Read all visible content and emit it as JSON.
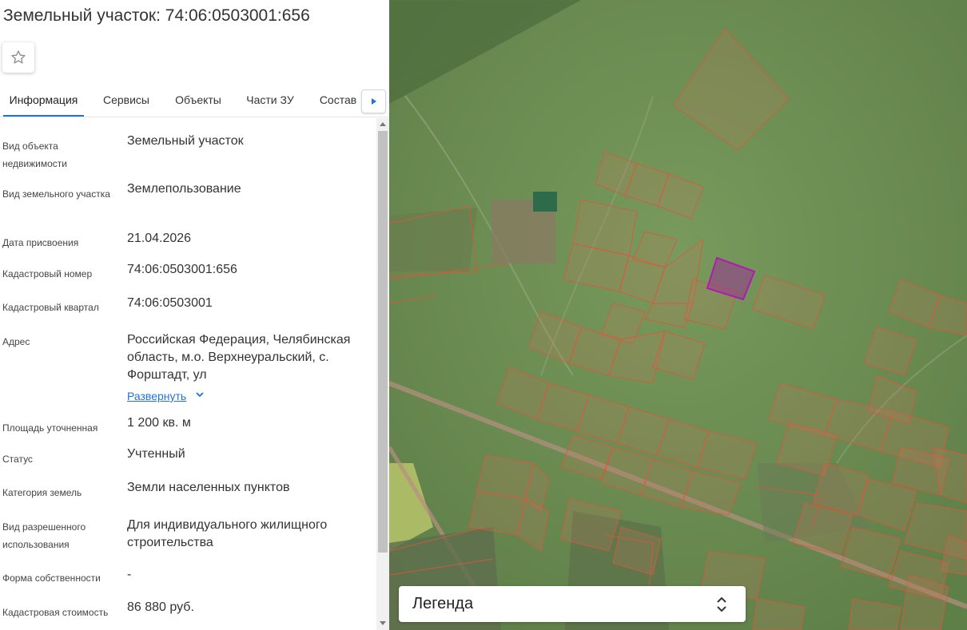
{
  "header": {
    "title": "Земельный участок: 74:06:0503001:656"
  },
  "tabs": [
    {
      "label": "Информация",
      "active": true
    },
    {
      "label": "Сервисы",
      "active": false
    },
    {
      "label": "Объекты",
      "active": false
    },
    {
      "label": "Части ЗУ",
      "active": false
    },
    {
      "label": "Состав",
      "active": false
    }
  ],
  "info": {
    "object_type": {
      "label": "Вид объекта недвижимости",
      "value": "Земельный участок"
    },
    "plot_type": {
      "label": "Вид земельного участка",
      "value": "Землепользование"
    },
    "date": {
      "label": "Дата присвоения",
      "value": "21.04.2026"
    },
    "cad_number": {
      "label": "Кадастровый номер",
      "value": "74:06:0503001:656"
    },
    "cad_quarter": {
      "label": "Кадастровый квартал",
      "value": "74:06:0503001"
    },
    "address": {
      "label": "Адрес",
      "value": "Российская Федерация, Челябинская область, м.о. Верхнеуральский, с. Форштадт, ул",
      "expand_label": "Развернуть"
    },
    "area": {
      "label": "Площадь уточненная",
      "value": "1 200 кв. м"
    },
    "status": {
      "label": "Статус",
      "value": "Учтенный"
    },
    "category": {
      "label": "Категория земель",
      "value": "Земли населенных пунктов"
    },
    "permitted_use": {
      "label": "Вид разрешенного использования",
      "value": "Для индивидуального жилищного строительства"
    },
    "ownership": {
      "label": "Форма собственности",
      "value": "-"
    },
    "cad_value": {
      "label": "Кадастровая стоимость",
      "value": "86 880 руб."
    }
  },
  "legend": {
    "title": "Легенда"
  },
  "colors": {
    "accent": "#1e73d8",
    "parcel_outline": "#e0553a",
    "selected_parcel": "#a020a0",
    "map_grass": "#6b8a52"
  },
  "icons": {
    "favorite": "star-outline-icon",
    "tabs_next": "caret-right-icon",
    "expand": "chevron-down-icon",
    "legend_toggle": "unfold-icon"
  }
}
